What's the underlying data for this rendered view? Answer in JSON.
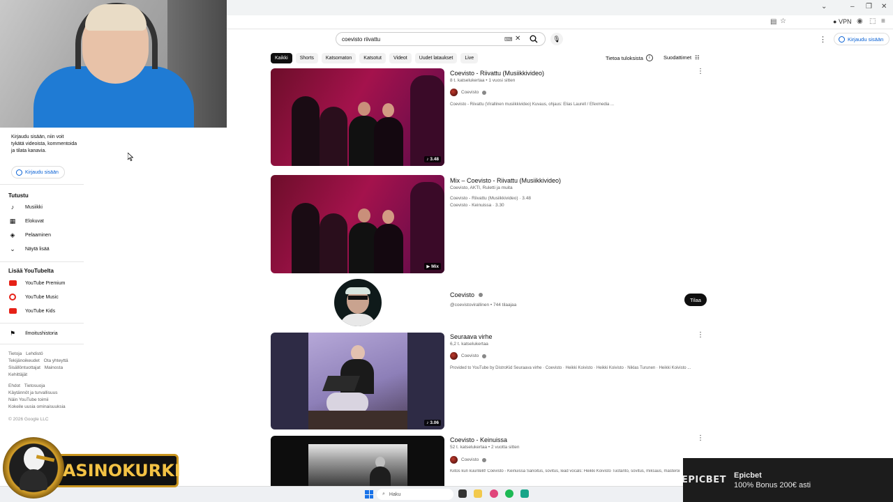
{
  "browser": {
    "vpn_label": "VPN"
  },
  "sidebar": {
    "signin_prompt": "Kirjaudu sisään, niin voit tykätä videoista, kommentoida ja tilata kanavia.",
    "signin_button": "Kirjaudu sisään",
    "explore_title": "Tutustu",
    "explore_items": [
      {
        "label": "Musiikki",
        "icon": "music-note-icon"
      },
      {
        "label": "Elokuvat",
        "icon": "film-icon"
      },
      {
        "label": "Pelaaminen",
        "icon": "gamepad-icon"
      },
      {
        "label": "Näytä lisää",
        "icon": "chevron-down-icon"
      }
    ],
    "more_title": "Lisää YouTubelta",
    "more_items": [
      {
        "label": "YouTube Premium",
        "icon": "youtube-premium-icon"
      },
      {
        "label": "YouTube Music",
        "icon": "youtube-music-icon"
      },
      {
        "label": "YouTube Kids",
        "icon": "youtube-kids-icon"
      }
    ],
    "report_history": "Ilmoitushistoria",
    "footer_links_1": [
      "Tietoja",
      "Lehdistö",
      "Tekijänoikeudet",
      "Ota yhteyttä",
      "Sisällöntuottajat",
      "Mainosta",
      "Kehittäjät"
    ],
    "footer_links_2": [
      "Ehdot",
      "Tietosuoja",
      "Käytännöt ja turvallisuus",
      "Näin YouTube toimii",
      "Kokeile uusia ominaisuuksia"
    ],
    "copyright": "© 2026 Google LLC"
  },
  "header": {
    "search_value": "coevisto riivattu",
    "signin_button": "Kirjaudu sisään"
  },
  "chips": [
    "Kaikki",
    "Shorts",
    "Katsomaton",
    "Katsotut",
    "Videot",
    "Uudet lataukset",
    "Live"
  ],
  "about_results": "Tietoa tuloksista",
  "filters": "Suodattimet",
  "results": [
    {
      "title": "Coevisto - Riivattu (Musiikkivideo)",
      "meta": "8 t. katselukertaa • 1 vuosi sitten",
      "channel": "Coevisto",
      "description": "Coevisto - Riivattu (Virallinen musiikkivideo) Kuvaus, ohjaus: Elias Laurell / Efexmedia ...",
      "duration": "♪ 3.48"
    },
    {
      "title": "Mix – Coevisto - Riivattu (Musiikkivideo)",
      "meta": "Coevisto, AKTI, Ruletti ja muita",
      "line1": "Coevisto - Riivattu (Musiikkivideo) · 3.48",
      "line2": "Coevisto - Keinuissa · 3.30",
      "badge": "▶ Mix"
    },
    {
      "channel_name": "Coevisto",
      "handle": "@coevistovirallinen • 744 tilaajaa",
      "subscribe": "Tilaa"
    },
    {
      "title": "Seuraava virhe",
      "meta": "6,2 t. katselukertaa",
      "channel": "Coevisto",
      "description": "Provided to YouTube by DistroKid Seuraava virhe · Coevisto · Heikki Koivisto · Heikki Koivisto · Niklas Turunen · Heikki Koivisto ...",
      "duration": "♪ 3.06"
    },
    {
      "title": "Coevisto - Keinuissa",
      "meta": "52 t. katselukertaa • 2 vuotta sitten",
      "channel": "Coevisto",
      "description": "Kiitos kun kuuntelit! Coevisto - Keinuissa Sanoitus, sovitus, lead vocals: Heikki Koivisto Tuotanto, sovitus, miksaus, masterointi ..."
    }
  ],
  "taskbar": {
    "search_placeholder": "Haku"
  },
  "overlay": {
    "logo_text": "KASINOKURKI",
    "ad_brand": "EPICBET",
    "ad_title": "Epicbet",
    "ad_subtitle": "100% Bonus 200€ asti"
  },
  "colors": {
    "accent": "#065fd4",
    "brand_red": "#e62117",
    "logo_gold": "#f3c244"
  }
}
